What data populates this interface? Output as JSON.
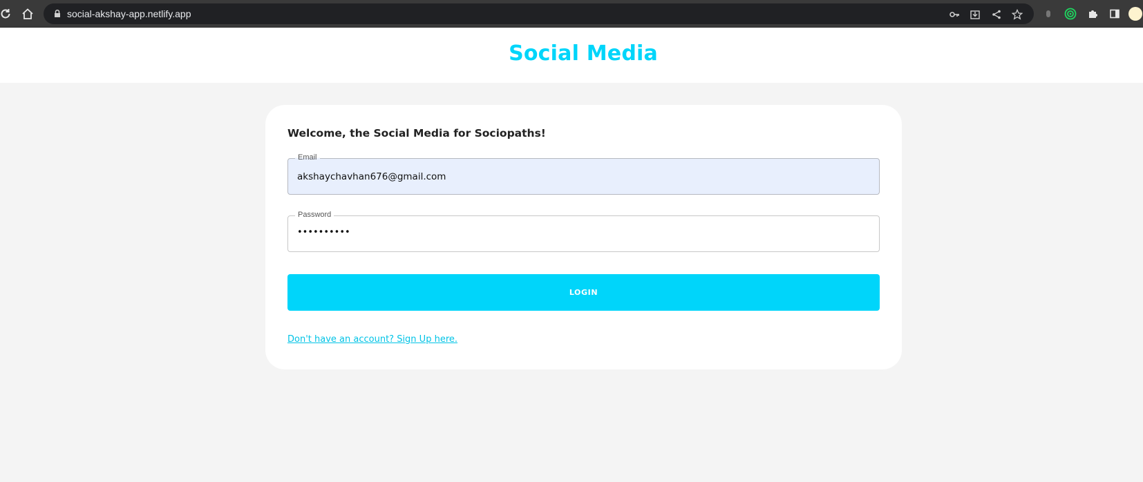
{
  "browser": {
    "url": "social-akshay-app.netlify.app"
  },
  "app": {
    "title": "Social Media",
    "accent_color": "#00d5fa"
  },
  "login_form": {
    "welcome": "Welcome, the Social Media for Sociopaths!",
    "email_label": "Email",
    "email_value": "akshaychavhan676@gmail.com",
    "password_label": "Password",
    "password_value": "••••••••••",
    "login_button": "LOGIN",
    "signup_link": "Don't have an account? Sign Up here."
  },
  "icons": {
    "reload": "reload-icon",
    "home": "home-icon",
    "lock": "lock-icon",
    "key": "key-icon",
    "install": "install-icon",
    "share": "share-icon",
    "bookmark": "star-icon",
    "extensions": "puzzle-icon",
    "sidepanel": "side-panel-icon"
  }
}
